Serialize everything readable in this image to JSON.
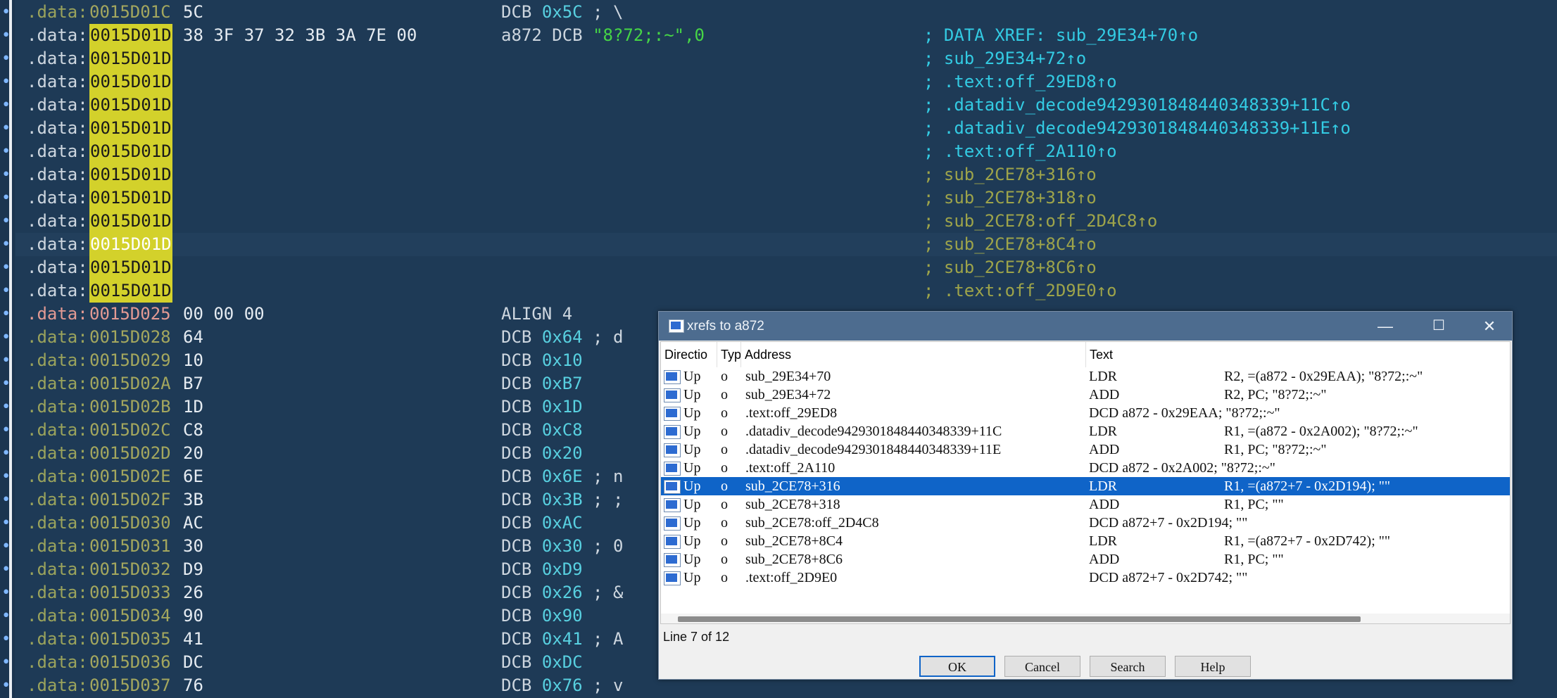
{
  "listing": {
    "rows": [
      {
        "seg": ".data:",
        "addr": "0015D01C",
        "bytes": "5C",
        "label": "",
        "mnem": "DCB",
        "op": "0x5C",
        "cmt": " ; \\",
        "xref": ""
      },
      {
        "seg": ".data:",
        "addr": "0015D01D",
        "bytes": "38 3F 37 32 3B 3A 7E 00",
        "label": "a872",
        "mnem": "DCB",
        "str": "\"8?72;:~\"",
        "zero": ",0",
        "xref": "; DATA XREF: sub_29E34+70↑o"
      },
      {
        "seg": ".data:",
        "addr": "0015D01D",
        "xref": "; sub_29E34+72↑o"
      },
      {
        "seg": ".data:",
        "addr": "0015D01D",
        "xref": "; .text:off_29ED8↑o"
      },
      {
        "seg": ".data:",
        "addr": "0015D01D",
        "xref": "; .datadiv_decode9429301848440348339+11C↑o"
      },
      {
        "seg": ".data:",
        "addr": "0015D01D",
        "xref": "; .datadiv_decode9429301848440348339+11E↑o"
      },
      {
        "seg": ".data:",
        "addr": "0015D01D",
        "xref": "; .text:off_2A110↑o"
      },
      {
        "seg": ".data:",
        "addr": "0015D01D",
        "xref": "; sub_2CE78+316↑o"
      },
      {
        "seg": ".data:",
        "addr": "0015D01D",
        "xref": "; sub_2CE78+318↑o"
      },
      {
        "seg": ".data:",
        "addr": "0015D01D",
        "xref": "; sub_2CE78:off_2D4C8↑o"
      },
      {
        "seg": ".data:",
        "addr": "0015D01D",
        "xref": "; sub_2CE78+8C4↑o"
      },
      {
        "seg": ".data:",
        "addr": "0015D01D",
        "xref": "; sub_2CE78+8C6↑o"
      },
      {
        "seg": ".data:",
        "addr": "0015D01D",
        "xref": "; .text:off_2D9E0↑o"
      },
      {
        "seg": ".data:",
        "addr": "0015D025",
        "bytes": "00 00 00",
        "mnem": "ALIGN 4",
        "op": "",
        "cmt": ""
      },
      {
        "seg": ".data:",
        "addr": "0015D028",
        "bytes": "64",
        "mnem": "DCB",
        "op": "0x64",
        "cmt": " ; d"
      },
      {
        "seg": ".data:",
        "addr": "0015D029",
        "bytes": "10",
        "mnem": "DCB",
        "op": "0x10",
        "cmt": ""
      },
      {
        "seg": ".data:",
        "addr": "0015D02A",
        "bytes": "B7",
        "mnem": "DCB",
        "op": "0xB7",
        "cmt": ""
      },
      {
        "seg": ".data:",
        "addr": "0015D02B",
        "bytes": "1D",
        "mnem": "DCB",
        "op": "0x1D",
        "cmt": ""
      },
      {
        "seg": ".data:",
        "addr": "0015D02C",
        "bytes": "C8",
        "mnem": "DCB",
        "op": "0xC8",
        "cmt": ""
      },
      {
        "seg": ".data:",
        "addr": "0015D02D",
        "bytes": "20",
        "mnem": "DCB",
        "op": "0x20",
        "cmt": ""
      },
      {
        "seg": ".data:",
        "addr": "0015D02E",
        "bytes": "6E",
        "mnem": "DCB",
        "op": "0x6E",
        "cmt": " ; n"
      },
      {
        "seg": ".data:",
        "addr": "0015D02F",
        "bytes": "3B",
        "mnem": "DCB",
        "op": "0x3B",
        "cmt": " ; ;"
      },
      {
        "seg": ".data:",
        "addr": "0015D030",
        "bytes": "AC",
        "mnem": "DCB",
        "op": "0xAC",
        "cmt": ""
      },
      {
        "seg": ".data:",
        "addr": "0015D031",
        "bytes": "30",
        "mnem": "DCB",
        "op": "0x30",
        "cmt": " ; 0"
      },
      {
        "seg": ".data:",
        "addr": "0015D032",
        "bytes": "D9",
        "mnem": "DCB",
        "op": "0xD9",
        "cmt": ""
      },
      {
        "seg": ".data:",
        "addr": "0015D033",
        "bytes": "26",
        "mnem": "DCB",
        "op": "0x26",
        "cmt": " ; &"
      },
      {
        "seg": ".data:",
        "addr": "0015D034",
        "bytes": "90",
        "mnem": "DCB",
        "op": "0x90",
        "cmt": ""
      },
      {
        "seg": ".data:",
        "addr": "0015D035",
        "bytes": "41",
        "mnem": "DCB",
        "op": "0x41",
        "cmt": " ; A"
      },
      {
        "seg": ".data:",
        "addr": "0015D036",
        "bytes": "DC",
        "mnem": "DCB",
        "op": "0xDC",
        "cmt": ""
      },
      {
        "seg": ".data:",
        "addr": "0015D037",
        "bytes": "76",
        "mnem": "DCB",
        "op": "0x76",
        "cmt": " ; v"
      }
    ]
  },
  "dialog": {
    "title": "xrefs to a872",
    "minimize": "—",
    "maximize": "☐",
    "close": "✕",
    "columns": {
      "direction": "Directio",
      "type": "Typ",
      "address": "Address",
      "text": "Text"
    },
    "rows": [
      {
        "dir": "Up",
        "typ": "o",
        "addr": "sub_29E34+70",
        "mn": "LDR",
        "ops": "R2, =(a872 - 0x29EAA); \"8?72;:~\""
      },
      {
        "dir": "Up",
        "typ": "o",
        "addr": "sub_29E34+72",
        "mn": "ADD",
        "ops": "R2, PC; \"8?72;:~\""
      },
      {
        "dir": "Up",
        "typ": "o",
        "addr": ".text:off_29ED8",
        "mn": "DCD a872 - 0x29EAA; \"8?72;:~\"",
        "ops": ""
      },
      {
        "dir": "Up",
        "typ": "o",
        "addr": ".datadiv_decode9429301848440348339+11C",
        "mn": "LDR",
        "ops": "R1, =(a872 - 0x2A002); \"8?72;:~\""
      },
      {
        "dir": "Up",
        "typ": "o",
        "addr": ".datadiv_decode9429301848440348339+11E",
        "mn": "ADD",
        "ops": "R1, PC; \"8?72;:~\""
      },
      {
        "dir": "Up",
        "typ": "o",
        "addr": ".text:off_2A110",
        "mn": "DCD a872 - 0x2A002; \"8?72;:~\"",
        "ops": ""
      },
      {
        "dir": "Up",
        "typ": "o",
        "addr": "sub_2CE78+316",
        "mn": "LDR",
        "ops": "R1, =(a872+7 - 0x2D194); \"\""
      },
      {
        "dir": "Up",
        "typ": "o",
        "addr": "sub_2CE78+318",
        "mn": "ADD",
        "ops": "R1, PC; \"\""
      },
      {
        "dir": "Up",
        "typ": "o",
        "addr": "sub_2CE78:off_2D4C8",
        "mn": "DCD a872+7 - 0x2D194; \"\"",
        "ops": ""
      },
      {
        "dir": "Up",
        "typ": "o",
        "addr": "sub_2CE78+8C4",
        "mn": "LDR",
        "ops": "R1, =(a872+7 - 0x2D742); \"\""
      },
      {
        "dir": "Up",
        "typ": "o",
        "addr": "sub_2CE78+8C6",
        "mn": "ADD",
        "ops": "R1, PC; \"\""
      },
      {
        "dir": "Up",
        "typ": "o",
        "addr": ".text:off_2D9E0",
        "mn": "DCD a872+7 - 0x2D742; \"\"",
        "ops": ""
      }
    ],
    "selected_row": 7,
    "status": "Line 7 of 12",
    "buttons": {
      "ok": "OK",
      "cancel": "Cancel",
      "search": "Search",
      "help": "Help"
    }
  },
  "colors": {
    "background": "#1e3a56",
    "address_highlight": "#d3d12b",
    "selection": "#0f64c8",
    "xref_cyan": "#33cbe3",
    "xref_olive": "#9ea44a",
    "string": "#46d546"
  },
  "icons": {
    "row_icon": "xref-entry-icon",
    "title_icon": "xref-window-icon"
  }
}
